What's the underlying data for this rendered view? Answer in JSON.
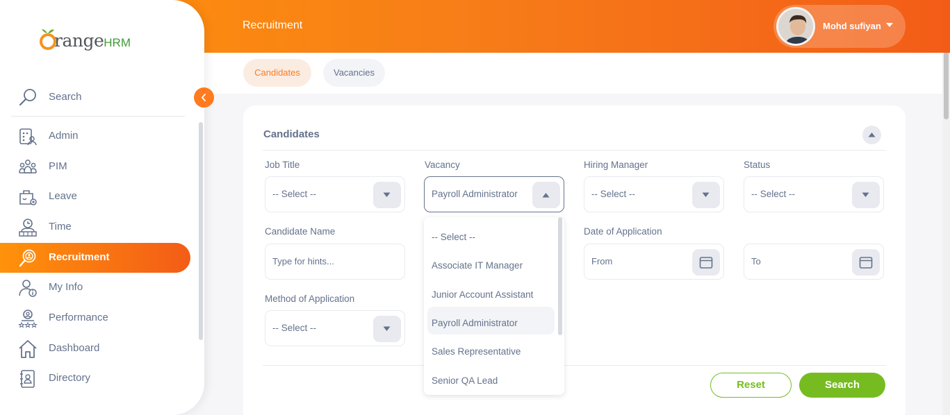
{
  "app": {
    "logo_main": "range",
    "logo_suffix": "HRM"
  },
  "header": {
    "module_title": "Recruitment",
    "user_name": "Mohd sufiyan"
  },
  "subnav": {
    "tabs": [
      {
        "label": "Candidates",
        "active": true
      },
      {
        "label": "Vacancies",
        "active": false
      }
    ]
  },
  "sidebar": {
    "search_label": "Search",
    "items": [
      {
        "label": "Admin",
        "icon": "admin-icon"
      },
      {
        "label": "PIM",
        "icon": "pim-icon"
      },
      {
        "label": "Leave",
        "icon": "leave-icon"
      },
      {
        "label": "Time",
        "icon": "time-icon"
      },
      {
        "label": "Recruitment",
        "icon": "recruitment-icon",
        "active": true
      },
      {
        "label": "My Info",
        "icon": "my-info-icon"
      },
      {
        "label": "Performance",
        "icon": "performance-icon"
      },
      {
        "label": "Dashboard",
        "icon": "dashboard-icon"
      },
      {
        "label": "Directory",
        "icon": "directory-icon"
      }
    ]
  },
  "filters": {
    "section_title": "Candidates",
    "job_title": {
      "label": "Job Title",
      "value": "-- Select --"
    },
    "vacancy": {
      "label": "Vacancy",
      "value": "Payroll Administrator"
    },
    "hiring_manager": {
      "label": "Hiring Manager",
      "value": "-- Select --"
    },
    "status": {
      "label": "Status",
      "value": "-- Select --"
    },
    "candidate_name": {
      "label": "Candidate Name",
      "placeholder": "Type for hints..."
    },
    "date_of_application": {
      "label": "Date of Application",
      "from_placeholder": "From",
      "to_placeholder": "To"
    },
    "method_of_application": {
      "label": "Method of Application",
      "value": "-- Select --"
    }
  },
  "vacancy_dropdown": {
    "options": [
      "-- Select --",
      "Associate IT Manager",
      "Junior Account Assistant",
      "Payroll Administrator",
      "Sales Representative",
      "Senior QA Lead"
    ],
    "highlighted": "Payroll Administrator"
  },
  "actions": {
    "reset_label": "Reset",
    "search_label": "Search"
  },
  "colors": {
    "brand_orange": "#ff7b1d",
    "accent_green": "#76bc21",
    "text": "#64728c"
  }
}
